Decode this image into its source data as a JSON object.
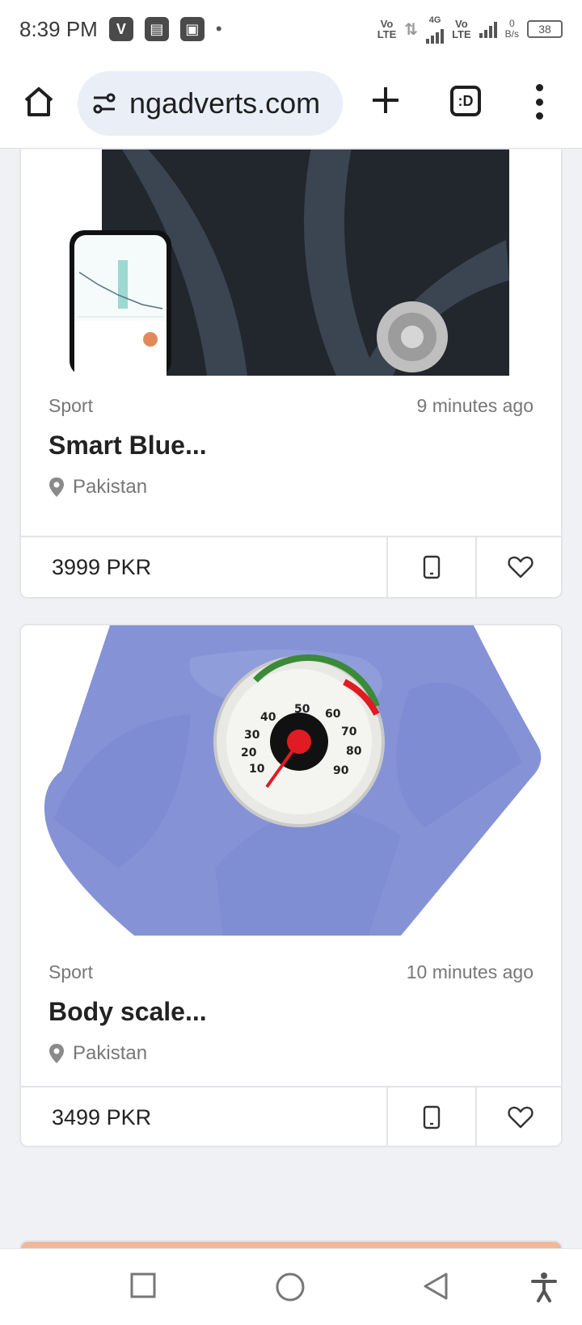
{
  "status_bar": {
    "time": "8:39 PM",
    "net_speed_value": "0",
    "net_speed_unit": "B/s",
    "battery": "38",
    "sim1_label_top": "Vo",
    "sim1_label_bottom": "LTE",
    "sim2_label_top": "Vo",
    "sim2_label_bottom": "LTE",
    "network_type": "4G"
  },
  "browser": {
    "url": "ngadverts.com",
    "tabs_label": ":D"
  },
  "listings": [
    {
      "category": "Sport",
      "time_ago": "9 minutes ago",
      "title": "Smart Blue...",
      "location": "Pakistan",
      "price": "3999 PKR"
    },
    {
      "category": "Sport",
      "time_ago": "10 minutes ago",
      "title": "Body scale...",
      "location": "Pakistan",
      "price": "3499 PKR"
    }
  ],
  "colors": {
    "scale1_dark": "#22262d",
    "scale2_blue": "#8593d6",
    "omnibox_bg": "#e9eef7",
    "dial_red": "#e01b24"
  }
}
